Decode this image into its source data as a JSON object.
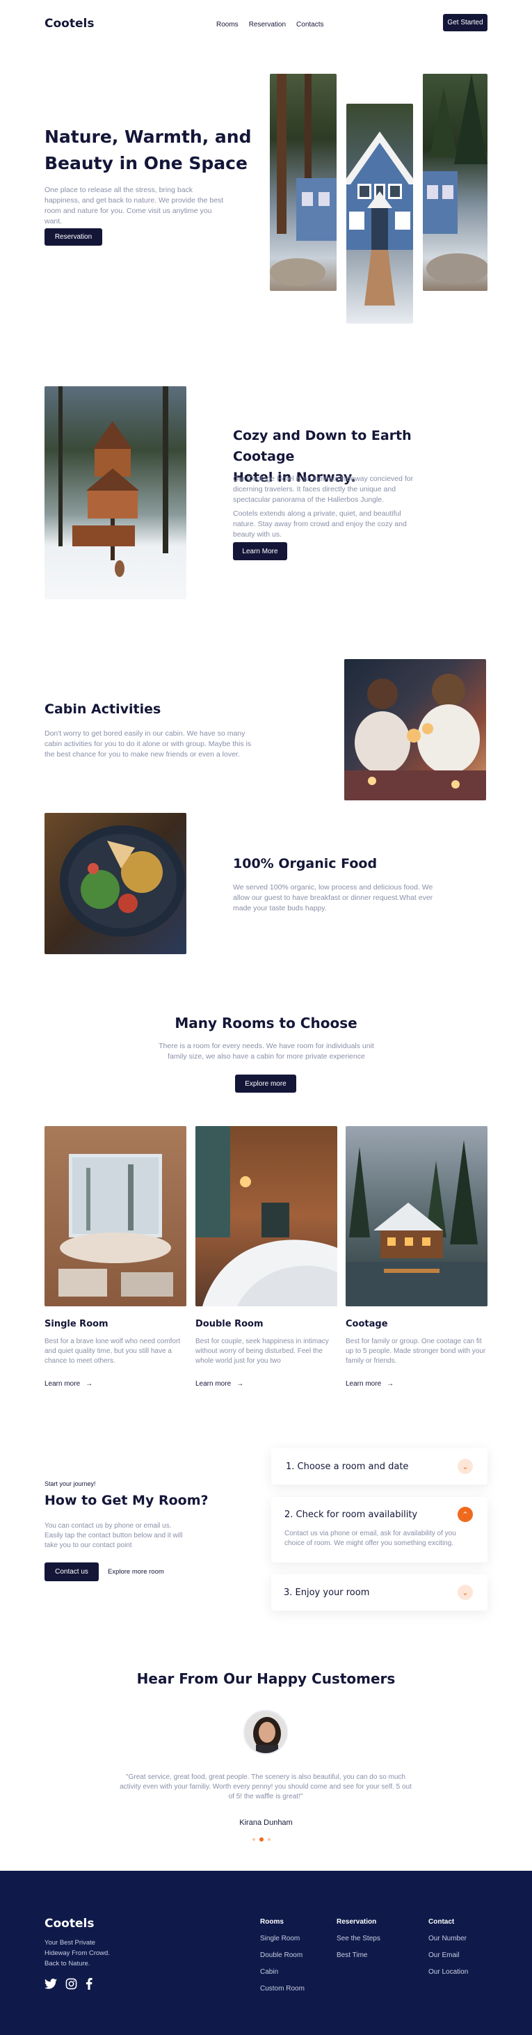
{
  "header": {
    "logo": "Cootels",
    "nav": [
      "Rooms",
      "Reservation",
      "Contacts"
    ],
    "cta": "Get Started"
  },
  "hero": {
    "title_line1": "Nature, Warmth, and",
    "title_line2": "Beauty in One Space",
    "text": "One place to release all the stress, bring back happiness, and get back to nature. We provide the best room and nature for you. Come visit us anytime you want.",
    "button": "Reservation"
  },
  "about": {
    "title_line1": "Cozy and Down to Earth Cootage",
    "title_line2": "Hotel in Norway.",
    "p1": "Our Cootage Hotel is an intimate hideway concieved for dicerning travelers. It faces directly the unique and spectacular panorama of the Hallerbos Jungle.",
    "p2": "Cootels extends along a private, quiet, and beautiful nature. Stay away from crowd and enjoy the cozy and beauty with us.",
    "button": "Learn More"
  },
  "activities": {
    "title": "Cabin Activities",
    "text": "Don't worry to get bored easily in our cabin. We have so many cabin activities for you to do it alone or with group. Maybe this is the best chance for you to make new friends or even a lover."
  },
  "food": {
    "title": "100% Organic Food",
    "text": "We served 100% organic, low process and delicious food. We allow our guest to have breakfast or dinner request.What ever made your taste buds happy."
  },
  "rooms": {
    "title": "Many Rooms to Choose",
    "text": "There is a room for every needs. We have room for individuals unit family size, we also have a cabin for more private experience",
    "button": "Explore more",
    "items": [
      {
        "name": "Single Room",
        "desc": "Best for a brave lone wolf who need comfort and quiet quality time, but you still have a chance to meet others.",
        "link": "Learn more"
      },
      {
        "name": "Double Room",
        "desc": "Best for couple, seek happiness in intimacy without worry of being disturbed. Feel the whole world just for you two",
        "link": "Learn more"
      },
      {
        "name": "Cootage",
        "desc": "Best for family or group. One cootage can fit up to 5 people. Made stronger bond with your family or friends.",
        "link": "Learn more"
      }
    ]
  },
  "howto": {
    "eyebrow": "Start your journey!",
    "title": "How to Get My Room?",
    "text": "You can contact us by phone or email us. Easily tap the contact button below and it will take you to our contact point",
    "button": "Contact us",
    "secondary": "Explore more room",
    "steps": [
      {
        "title": "1. Choose a room and date",
        "open": false
      },
      {
        "title": "2. Check for room availability",
        "open": true,
        "body": "Contact us via phone or email, ask for availability of you choice of room. We might offer you something exciting."
      },
      {
        "title": "3. Enjoy your room",
        "open": false
      }
    ]
  },
  "testimonial": {
    "title": "Hear From Our Happy Customers",
    "quote": "\"Great service, great food, great people. The scenery is also beautiful, you can do so much activity even with your familiy. Worth every penny! you should come and see for your self. 5 out of 5! the waffle is great!\"",
    "name": "Kirana Dunham",
    "dots": 3,
    "active_dot": 1
  },
  "footer": {
    "logo": "Cootels",
    "tagline_1": "Your Best Private",
    "tagline_2": "Hideway From Crowd.",
    "tagline_3": "Back to Nature.",
    "columns": [
      {
        "title": "Rooms",
        "links": [
          "Single Room",
          "Double Room",
          "Cabin",
          "Custom Room"
        ]
      },
      {
        "title": "Reservation",
        "links": [
          "See the Steps",
          "Best Time"
        ]
      },
      {
        "title": "Contact",
        "links": [
          "Our Number",
          "Our Email",
          "Our Location"
        ]
      }
    ],
    "social": [
      "twitter-icon",
      "instagram-icon",
      "facebook-icon"
    ]
  },
  "colors": {
    "navy": "#141638",
    "accent": "#f06a1e",
    "footer": "#0f1a4a"
  }
}
